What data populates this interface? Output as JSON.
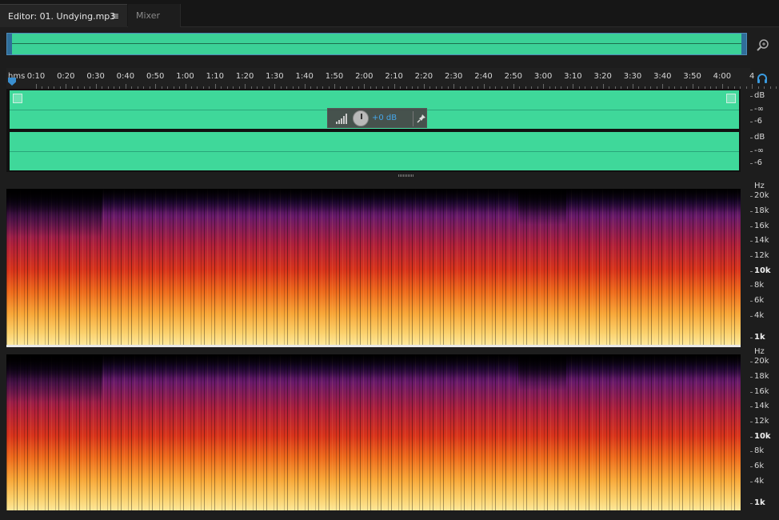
{
  "tabs": {
    "editor_label": "Editor: 01. Undying.mp3",
    "menu_glyph": "≡",
    "mixer_label": "Mixer"
  },
  "icons": {
    "zoom": "zoom-icon",
    "headphones": "headphones-icon",
    "pin": "pin-icon",
    "volume": "volume-bars-icon",
    "knob": "volume-knob-icon"
  },
  "ruler": {
    "unit": "hms",
    "labels": [
      "0:10",
      "0:20",
      "0:30",
      "0:40",
      "0:50",
      "1:00",
      "1:10",
      "1:20",
      "1:30",
      "1:40",
      "1:50",
      "2:00",
      "2:10",
      "2:20",
      "2:30",
      "2:40",
      "2:50",
      "3:00",
      "3:10",
      "3:20",
      "3:30",
      "3:40",
      "3:50",
      "4:00",
      "4"
    ]
  },
  "hud": {
    "value": "+0 dB",
    "pin_glyph": "✦"
  },
  "wave_scale": {
    "ch1": [
      "dB",
      "-∞",
      "-6"
    ],
    "ch2": [
      "dB",
      "-∞",
      "-6"
    ]
  },
  "spectral_scale": {
    "unit": "Hz",
    "labels": [
      "20k",
      "18k",
      "16k",
      "14k",
      "12k",
      "10k",
      "8k",
      "6k",
      "4k",
      "1k"
    ]
  },
  "colors": {
    "waveform": "#3fd89a",
    "accent": "#3a8fd0",
    "hud_value": "#46a6e8",
    "background": "#1d1d1d"
  }
}
